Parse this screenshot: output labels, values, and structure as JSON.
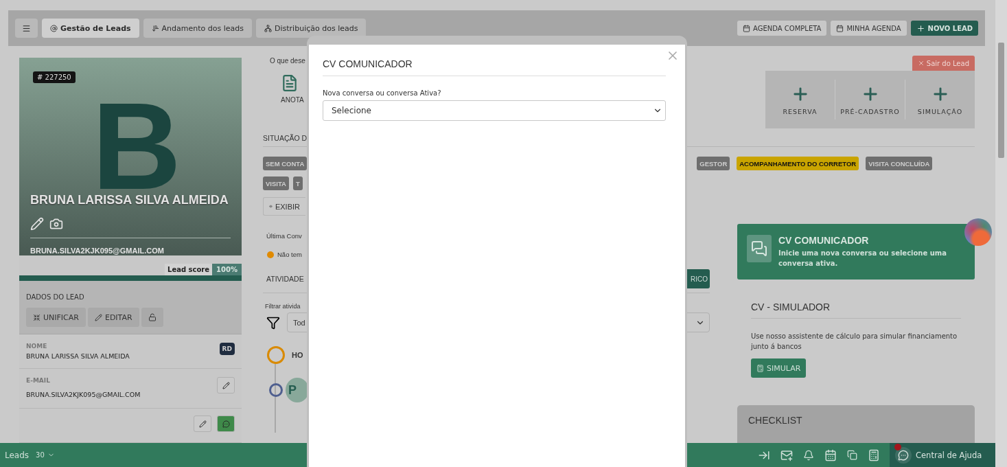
{
  "top_bar": {
    "tabs": [
      {
        "label": "Gestão de Leads",
        "selected": true
      },
      {
        "label": "Andamento dos leads",
        "selected": false
      },
      {
        "label": "Distribuição dos leads",
        "selected": false
      }
    ],
    "actions": [
      {
        "label": "AGENDA COMPLETA",
        "kind": "calendar"
      },
      {
        "label": "MINHA AGENDA",
        "kind": "calendar"
      },
      {
        "label": "NOVO LEAD",
        "kind": "primary"
      }
    ]
  },
  "lead_card": {
    "id_badge": "# 227250",
    "avatar_letter": "B",
    "name": "BRUNA LARISSA SILVA ALMEIDA",
    "email": "BRUNA.SILVA2KJK095@GMAIL.COM",
    "lead_score": {
      "label": "Lead score",
      "value": "100%",
      "level": 1
    },
    "section_title": "DADOS DO LEAD",
    "buttons": [
      "UNIFICAR",
      "EDITAR"
    ],
    "fields": [
      {
        "label": "NOME",
        "value": "BRUNA LARISSA SILVA ALMEIDA",
        "kind": "badge",
        "badge": "RD"
      },
      {
        "label": "E-MAIL",
        "value": "BRUNA.SILVA2KJK095@GMAIL.COM",
        "kind": "editable"
      }
    ]
  },
  "main": {
    "prompt": "O que dese",
    "quick_action": "ANOTA",
    "exit_button": "Sair do Lead",
    "create_actions": [
      "RESERVA",
      "PRÉ-CADASTRO",
      "SIMULAÇÃO"
    ],
    "situation_title": "SITUAÇÃO D",
    "stages_left": [
      {
        "label": "SEM CONTA",
        "color": "#6e6e6e"
      }
    ],
    "stages_right": [
      {
        "label": "GESTOR",
        "color": "#6e6e6e"
      },
      {
        "label": "ACOMPANHAMENTO DO CORRETOR",
        "color": "#c9a400"
      },
      {
        "label": "VISITA CONCLUÍDA",
        "color": "#6e6e6e"
      }
    ],
    "stages_second_row": [
      {
        "label": "VISITA",
        "color": "#6e6e6e"
      },
      {
        "label": "T",
        "color": "#6e6e6e"
      }
    ],
    "show_button": "EXIBIR",
    "last_conversation_label": "Última Conv",
    "last_conversation_status": "Não tem",
    "activities_title": "ATIVIDADE",
    "history_button": "RICO",
    "filter_label": "Filtrar ativida",
    "filter_value": "Tod",
    "timeline": [
      {
        "label": "HO",
        "kind": "day"
      },
      {
        "label": "P",
        "kind": "entry"
      }
    ]
  },
  "side": {
    "communicator": {
      "title": "CV COMUNICADOR",
      "text": "Inicie uma nova conversa ou selecione uma conversa ativa."
    },
    "simulator": {
      "title": "CV - SIMULADOR",
      "text": "Use nosso assistente de cálculo para simular financiamento junto á bancos",
      "button": "SIMULAR"
    },
    "checklist": {
      "title": "CHECKLIST"
    }
  },
  "bottom_bar": {
    "label": "Leads",
    "count": "30",
    "help": "Central de Ajuda"
  },
  "modal": {
    "title": "CV COMUNICADOR",
    "field_label": "Nova conversa ou conversa Ativa?",
    "select_value": "Selecione"
  }
}
